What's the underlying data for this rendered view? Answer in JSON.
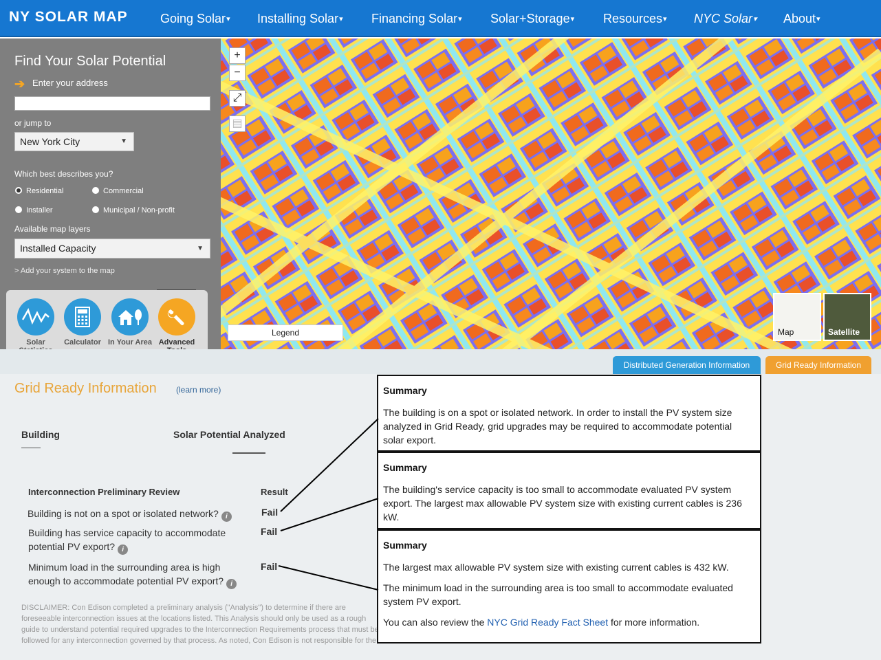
{
  "nav": {
    "brand": "NY SOLAR MAP",
    "items": [
      "Going Solar",
      "Installing Solar",
      "Financing Solar",
      "Solar+Storage",
      "Resources",
      "NYC Solar",
      "About"
    ]
  },
  "sidebar": {
    "title": "Find Your Solar Potential",
    "address_label": "Enter your address",
    "address_value": "",
    "jump_label": "or jump to",
    "jump_value": "New York City",
    "describe_label": "Which best describes you?",
    "options": [
      "Residential",
      "Commercial",
      "Installer",
      "Municipal / Non-profit"
    ],
    "selected_option": "Residential",
    "layers_label": "Available map layers",
    "layers_value": "Installed Capacity",
    "add_system": "> Add your system to the map",
    "tools": [
      {
        "label": "Solar Statistics",
        "icon": "wave-chart-icon",
        "color": "#2e9ad8"
      },
      {
        "label": "Calculator",
        "icon": "calculator-icon",
        "color": "#2e9ad8"
      },
      {
        "label": "In Your Area",
        "icon": "house-tree-icon",
        "color": "#2e9ad8"
      },
      {
        "label": "Advanced Tools",
        "icon": "wrench-icon",
        "color": "#f5a623"
      }
    ]
  },
  "map": {
    "zoom_in": "+",
    "zoom_out": "−",
    "legend": "Legend",
    "basemaps": [
      "Map",
      "Satellite"
    ]
  },
  "tabs": [
    {
      "label": "Distributed Generation Information",
      "color": "#2e9ad8"
    },
    {
      "label": "Grid Ready Information",
      "color": "#f0a030"
    }
  ],
  "grid_ready": {
    "title": "Grid Ready Information",
    "learn_more": "(learn more)",
    "building_header": "Building",
    "solar_header": "Solar Potential Analyzed",
    "review_header": "Interconnection Preliminary Review",
    "result_header": "Result",
    "questions": [
      {
        "text": "Building is not on a spot or isolated network?",
        "result": "Fail"
      },
      {
        "text": "Building has service capacity to accommodate potential PV export?",
        "result": "Fail"
      },
      {
        "text": "Minimum load in the surrounding area is high enough to accommodate potential PV export?",
        "result": "Fail"
      }
    ],
    "disclaimer": "DISCLAIMER: Con Edison completed a preliminary analysis (\"Analysis\") to determine if there are foreseeable interconnection issues at the locations listed. This Analysis should only be used as a rough guide to understand potential required upgrades to the Interconnection Requirements process that must be followed for any interconnection governed by that process. As noted, Con Edison is not responsible for the information included on the NYC Grid Ready website. The information presented in Grid Ready"
  },
  "summaries": [
    {
      "title": "Summary",
      "paragraphs": [
        "The building is on a spot or isolated network. In order to install the PV system size analyzed in Grid Ready, grid upgrades may be required to accommodate potential solar export."
      ]
    },
    {
      "title": "Summary",
      "paragraphs": [
        "The building's service capacity is too small to accommodate evaluated PV system export. The largest max allowable PV system size with existing current cables is 236 kW."
      ]
    },
    {
      "title": "Summary",
      "paragraphs": [
        "The largest max allowable PV system size with existing current cables is 432 kW.",
        "The minimum load in the surrounding area is too small to accommodate evaluated system PV export."
      ],
      "review_prefix": "You can also review the ",
      "link_text": "NYC Grid Ready Fact Sheet",
      "review_suffix": " for more information."
    }
  ]
}
